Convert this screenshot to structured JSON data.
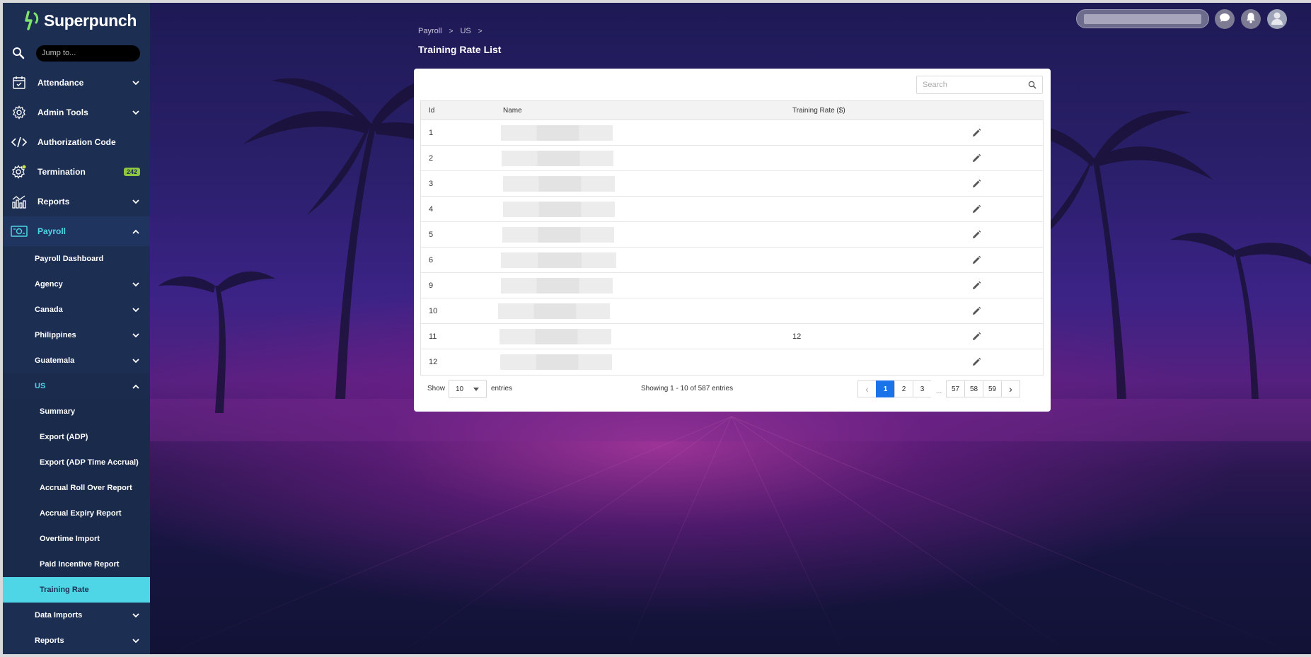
{
  "app": {
    "name": "Superpunch"
  },
  "sidebar": {
    "jump_placeholder": "Jump to...",
    "items": [
      {
        "label": "Attendance",
        "icon": "calendar-icon"
      },
      {
        "label": "Admin Tools",
        "icon": "gear-icon"
      },
      {
        "label": "Authorization Code",
        "icon": "code-icon"
      },
      {
        "label": "Termination",
        "icon": "gear-icon",
        "badge": "242"
      },
      {
        "label": "Reports",
        "icon": "chart-icon"
      },
      {
        "label": "Payroll",
        "icon": "money-icon"
      }
    ],
    "payroll_items": [
      {
        "label": "Payroll Dashboard"
      },
      {
        "label": "Agency"
      },
      {
        "label": "Canada"
      },
      {
        "label": "Philippines"
      },
      {
        "label": "Guatemala"
      },
      {
        "label": "US"
      }
    ],
    "us_items": [
      {
        "label": "Summary"
      },
      {
        "label": "Export (ADP)"
      },
      {
        "label": "Export (ADP Time Accrual)"
      },
      {
        "label": "Accrual Roll Over Report"
      },
      {
        "label": "Accrual Expiry Report"
      },
      {
        "label": "Overtime Import"
      },
      {
        "label": "Paid Incentive Report"
      },
      {
        "label": "Training Rate"
      }
    ],
    "more_items": [
      {
        "label": "Data Imports"
      },
      {
        "label": "Reports"
      }
    ]
  },
  "breadcrumb": {
    "level1": "Payroll",
    "level2": "US",
    "separator": ">"
  },
  "page": {
    "title": "Training Rate List"
  },
  "table": {
    "search_placeholder": "Search",
    "columns": {
      "id": "Id",
      "name": "Name",
      "rate": "Training Rate ($)"
    },
    "rows": [
      {
        "id": "1",
        "rate": ""
      },
      {
        "id": "2",
        "rate": ""
      },
      {
        "id": "3",
        "rate": ""
      },
      {
        "id": "4",
        "rate": ""
      },
      {
        "id": "5",
        "rate": ""
      },
      {
        "id": "6",
        "rate": ""
      },
      {
        "id": "9",
        "rate": ""
      },
      {
        "id": "10",
        "rate": ""
      },
      {
        "id": "11",
        "rate": "12"
      },
      {
        "id": "12",
        "rate": ""
      }
    ]
  },
  "footer": {
    "show_label": "Show",
    "page_size": "10",
    "entries_label": "entries",
    "showing_text": "Showing 1 - 10 of 587 entries",
    "pages": [
      "1",
      "2",
      "3",
      "...",
      "57",
      "58",
      "59"
    ],
    "prev": "‹",
    "next": "›"
  },
  "colors": {
    "accent": "#4fd6e6",
    "sidebar": "#1c2e52",
    "badge": "#8dc63f",
    "active_page": "#1a73e8"
  }
}
